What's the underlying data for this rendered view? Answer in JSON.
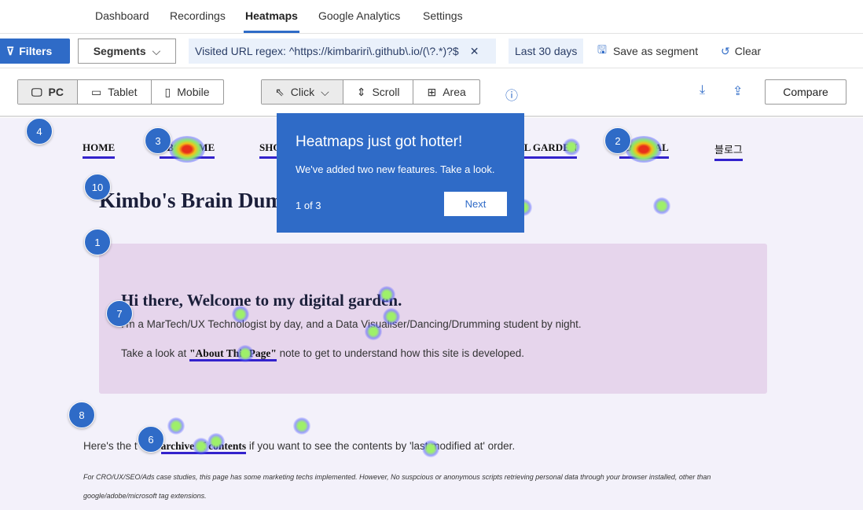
{
  "tabs": [
    "Dashboard",
    "Recordings",
    "Heatmaps",
    "Google Analytics",
    "Settings"
  ],
  "filters": {
    "filters_label": "Filters",
    "segments_label": "Segments",
    "url_chip": "Visited URL regex: ^https://kimbariri\\.github\\.io/(\\?.*)?$",
    "date_chip": "Last 30 days",
    "save_segment": "Save as segment",
    "clear": "Clear"
  },
  "toolbar": {
    "pc": "PC",
    "tablet": "Tablet",
    "mobile": "Mobile",
    "click": "Click",
    "scroll": "Scroll",
    "area": "Area",
    "compare": "Compare"
  },
  "popup": {
    "title": "Heatmaps just got hotter!",
    "desc": "We've added two new features. Take a look.",
    "counter": "1 of 3",
    "next": "Next"
  },
  "site": {
    "nav": [
      "HOME",
      "ABOUT ME",
      "SHOP",
      "DIGITAL GARDEN",
      "JOURNAL",
      "블로그"
    ],
    "title": "Kimbo's Brain Dump",
    "hero_title": "Hi there, Welcome to my digital garden.",
    "hero_line1": "I'm a MarTech/UX Technologist by day, and a Data Visualiser/Dancing/Drumming student by night.",
    "hero_line2_pre": "Take a look at ",
    "hero_link": "\"About This Page\"",
    "hero_line2_post": " note to get to understand how this site is developed.",
    "para_pre": "Here's the t",
    "para_link": "archive of contents",
    "para_post": " if you want to see the contents by 'last modified at' order.",
    "fine1": "For CRO/UX/SEO/Ads case studies, this page has some marketing techs implemented. However, No suspcious or anonymous scripts retrieving personal data through your browser installed, other than",
    "fine2": "google/adobe/microsoft tag extensions."
  },
  "badges": [
    "4",
    "3",
    "2",
    "10",
    "1",
    "7",
    "8",
    "6"
  ],
  "accent": "#2f6bc7"
}
